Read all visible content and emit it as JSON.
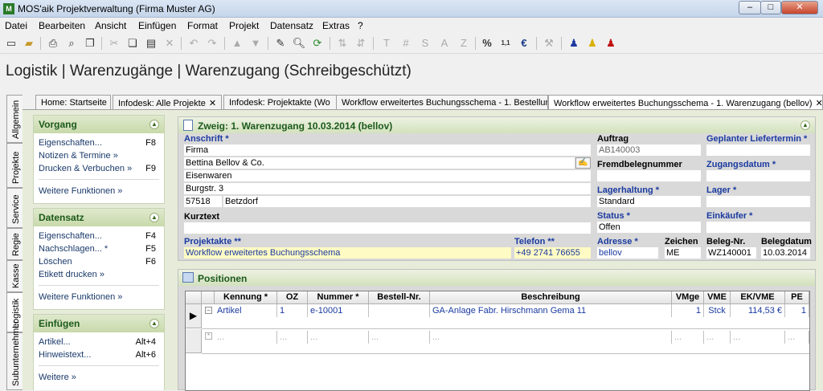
{
  "window": {
    "title": "MOS'aik Projektverwaltung (Firma Muster AG)",
    "min": "–",
    "max": "□",
    "close": "✕"
  },
  "menu": [
    "Datei",
    "Bearbeiten",
    "Ansicht",
    "Einfügen",
    "Format",
    "Projekt",
    "Datensatz",
    "Extras",
    "?"
  ],
  "toolbar": {
    "text_icons": [
      "T",
      "#",
      "S",
      "A",
      "Z"
    ]
  },
  "breadcrumb": "Logistik | Warenzugänge | Warenzugang (Schreibgeschützt)",
  "tabs": [
    {
      "label": "Home: Startseite",
      "close": ""
    },
    {
      "label": "Infodesk: Alle Projekte",
      "close": "✕"
    },
    {
      "label": "Infodesk: Projektakte (Wo",
      "close": ""
    },
    {
      "label": "Workflow erweitertes Buchungsschema - 1. Bestellun",
      "close": ""
    },
    {
      "label": "Workflow erweitertes Buchungsschema - 1. Warenzugang (bellov)",
      "close": "✕"
    }
  ],
  "vtabs": [
    "Allgemein",
    "Projekte",
    "Service",
    "Regie",
    "Kasse",
    "Logistik",
    "Subunternehmer"
  ],
  "sidebar": {
    "vorgang": {
      "title": "Vorgang",
      "items": [
        {
          "label": "Eigenschaften...",
          "key": "F8"
        },
        {
          "label": "Notizen & Termine »",
          "key": ""
        },
        {
          "label": "Drucken & Verbuchen »",
          "key": "F9"
        }
      ],
      "more": "Weitere Funktionen »"
    },
    "datensatz": {
      "title": "Datensatz",
      "items": [
        {
          "label": "Eigenschaften...",
          "key": "F4"
        },
        {
          "label": "Nachschlagen... *",
          "key": "F5"
        },
        {
          "label": "Löschen",
          "key": "F6"
        },
        {
          "label": "Etikett drucken »",
          "key": ""
        }
      ],
      "more": "Weitere Funktionen »"
    },
    "einfuegen": {
      "title": "Einfügen",
      "items": [
        {
          "label": "Artikel...",
          "key": "Alt+4"
        },
        {
          "label": "Hinweistext...",
          "key": "Alt+6"
        }
      ],
      "more": "Weitere »"
    }
  },
  "form": {
    "title": "Zweig: 1. Warenzugang 10.03.2014 (bellov)",
    "anschrift_label": "Anschrift *",
    "anschrift_lines": [
      "Firma",
      "Bettina Bellov & Co.",
      "Eisenwaren",
      "Burgstr. 3"
    ],
    "plz": "57518",
    "ort": "Betzdorf",
    "kurztext_label": "Kurztext",
    "kurztext": "",
    "auftrag_label": "Auftrag",
    "auftrag": "AB140003",
    "fremdbeleg_label": "Fremdbelegnummer",
    "fremdbeleg": "",
    "lagerhaltung_label": "Lagerhaltung *",
    "lagerhaltung": "Standard",
    "status_label": "Status *",
    "status": "Offen",
    "lieferdatum_label": "Geplanter Liefertermin *",
    "lieferdatum": "",
    "zugangsdatum_label": "Zugangsdatum *",
    "zugangsdatum": "",
    "lager_label": "Lager *",
    "lager": "",
    "einkaeufer_label": "Einkäufer *",
    "einkaeufer": "",
    "projektakte_label": "Projektakte **",
    "projektakte": "Workflow erweitertes Buchungsschema",
    "telefon_label": "Telefon **",
    "telefon": "+49 2741 76655",
    "adresse_label": "Adresse *",
    "adresse": "bellov",
    "zeichen_label": "Zeichen",
    "zeichen": "ME",
    "belegnr_label": "Beleg-Nr.",
    "belegnr": "WZ140001",
    "belegdatum_label": "Belegdatum",
    "belegdatum": "10.03.2014"
  },
  "positionen": {
    "title": "Positionen",
    "columns": [
      "Kennung *",
      "OZ",
      "Nummer *",
      "Bestell-Nr.",
      "Beschreibung",
      "VMge",
      "VME",
      "EK/VME",
      "PE"
    ],
    "rows": [
      {
        "kennung": "Artikel",
        "oz": "1",
        "nummer": "e-10001",
        "bestell": "",
        "beschreibung": "GA-Anlage Fabr. Hirschmann Gema 11",
        "vmge": "1",
        "vme": "Stck",
        "ek": "114,53 €",
        "pe": "1"
      },
      {
        "kennung": "...",
        "oz": "...",
        "nummer": "...",
        "bestell": "...",
        "beschreibung": "...",
        "vmge": "...",
        "vme": "...",
        "ek": "...",
        "pe": "..."
      }
    ]
  }
}
